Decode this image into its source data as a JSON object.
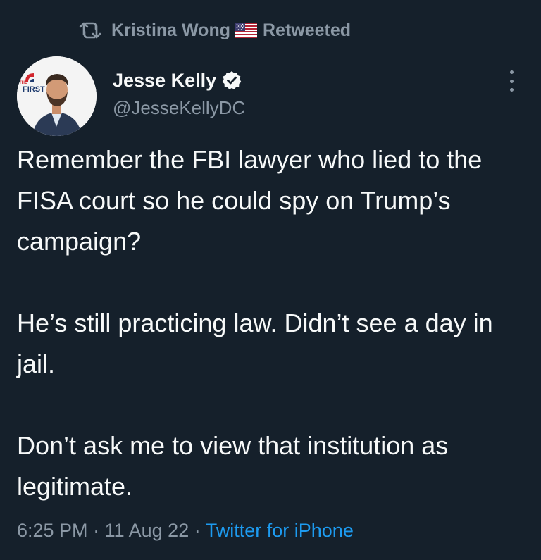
{
  "retweet": {
    "name": "Kristina Wong",
    "flag_icon": "us-flag-icon",
    "label": "Retweeted",
    "icon": "retweet-icon"
  },
  "author": {
    "display_name": "Jesse Kelly",
    "handle": "@JesseKellyDC",
    "verified_icon": "verified-badge-icon",
    "avatar_logo_text": "FIRST",
    "avatar_logo_small": "THE"
  },
  "tweet": {
    "paragraphs": [
      "Remember the FBI lawyer who lied to the FISA court so he could spy on Trump’s campaign?",
      "He’s still practicing law. Didn’t see a day in jail.",
      "Don’t ask me to view that institution as legitimate."
    ]
  },
  "meta": {
    "time": "6:25 PM",
    "separator": "·",
    "date": "11 Aug 22",
    "source": "Twitter for iPhone"
  },
  "colors": {
    "background": "#15202b",
    "text": "#f7f9f9",
    "secondary": "#8b98a5",
    "accent": "#1d9bf0"
  }
}
